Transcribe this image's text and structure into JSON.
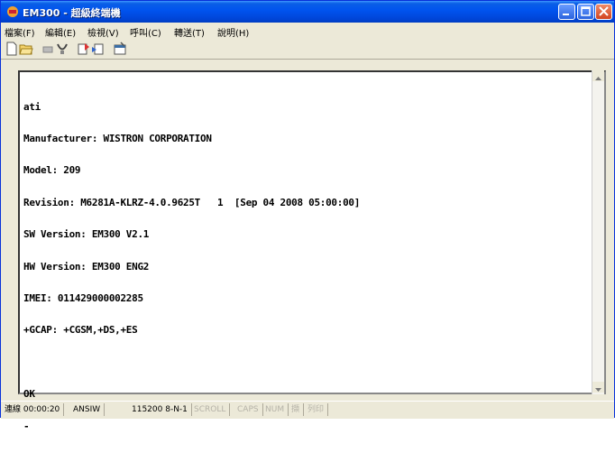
{
  "window": {
    "title": "EM300 - 超級終端機"
  },
  "menu": [
    "檔案(F)",
    "編輯(E)",
    "檢視(V)",
    "呼叫(C)",
    "轉送(T)",
    "說明(H)"
  ],
  "toolbar": [
    {
      "name": "new-connection-icon"
    },
    {
      "name": "open-icon"
    },
    {
      "name": "connect-icon"
    },
    {
      "name": "disconnect-icon"
    },
    {
      "name": "send-icon"
    },
    {
      "name": "receive-icon"
    },
    {
      "name": "properties-icon"
    }
  ],
  "terminal": {
    "lines": [
      "ati",
      "Manufacturer: WISTRON CORPORATION",
      "Model: 209",
      "Revision: M6281A-KLRZ-4.0.9625T   1  [Sep 04 2008 05:00:00]",
      "SW Version: EM300 V2.1",
      "HW Version: EM300 ENG2",
      "IMEI: 011429000002285",
      "+GCAP: +CGSM,+DS,+ES",
      "",
      "OK",
      "-"
    ]
  },
  "status": {
    "connected": "連線 00:00:20",
    "emulation": "ANSIW",
    "port": "115200 8-N-1",
    "scroll": "SCROLL",
    "caps": "CAPS",
    "num": "NUM",
    "capture": "擷",
    "echo": "列印"
  },
  "colors": {
    "titlebar": "#0053ee",
    "window": "#ece9d8",
    "terminal_bg": "#ffffff"
  }
}
